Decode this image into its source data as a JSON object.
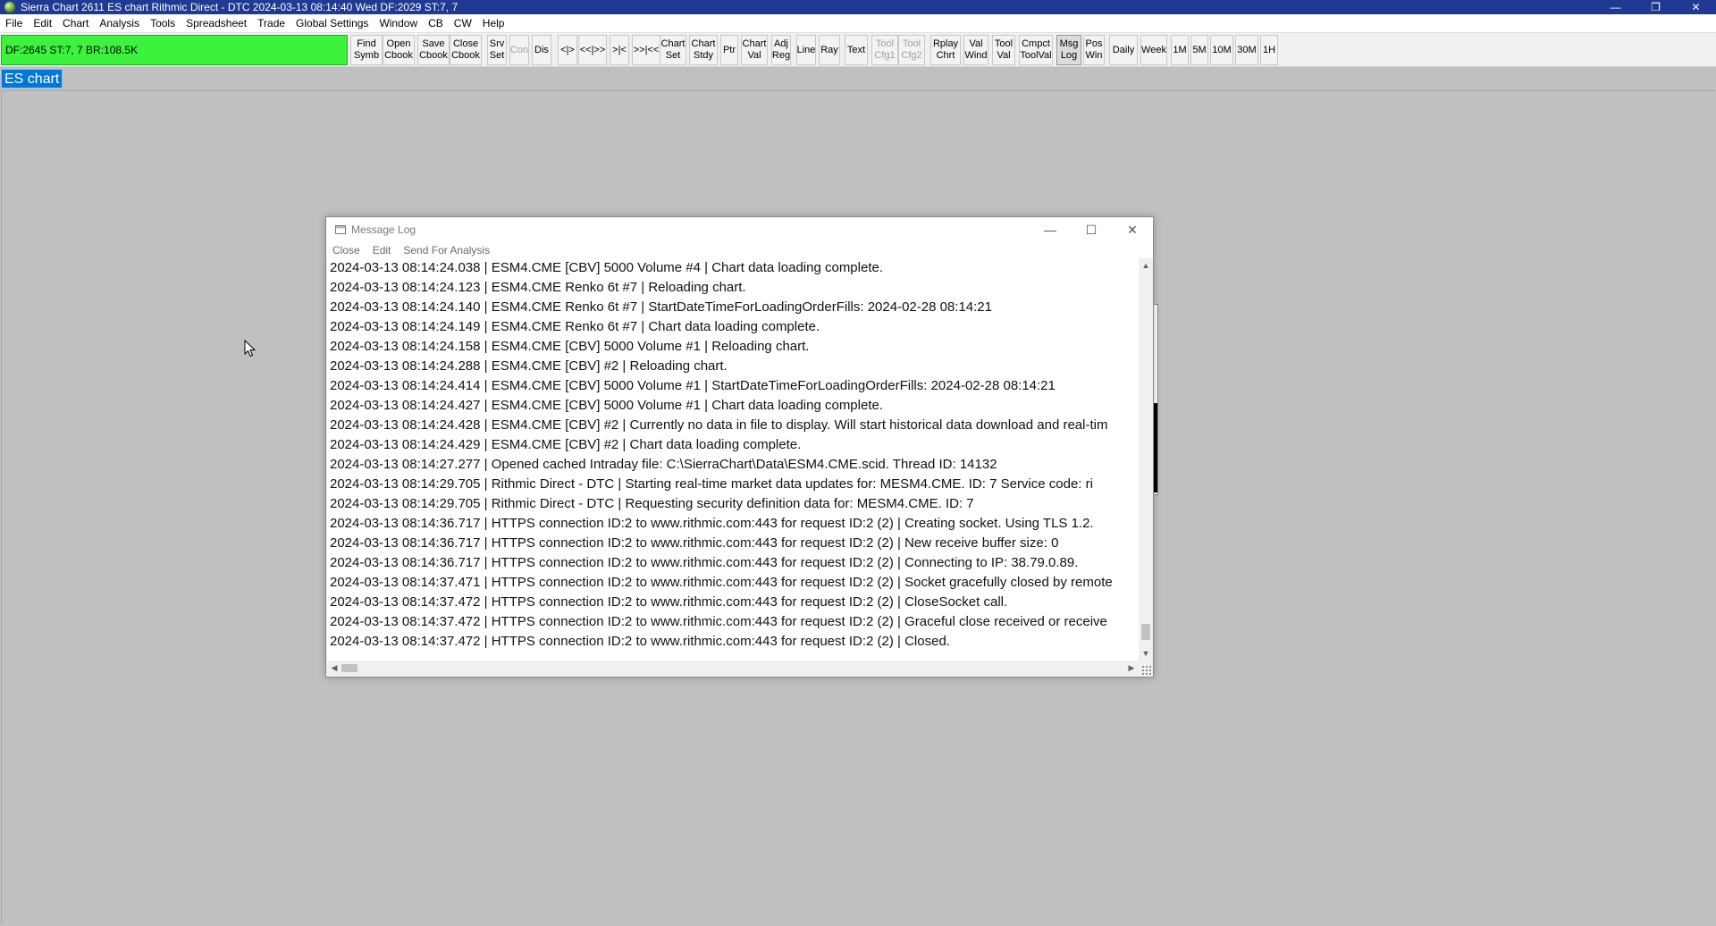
{
  "window": {
    "title": "Sierra Chart 2611 ES chart Rithmic Direct - DTC 2024-03-13  08:14:40 Wed DF:2029  ST:7, 7",
    "controls": {
      "minimize": "—",
      "restore": "❐",
      "close": "✕"
    }
  },
  "menu": [
    "File",
    "Edit",
    "Chart",
    "Analysis",
    "Tools",
    "Spreadsheet",
    "Trade",
    "Global Settings",
    "Window",
    "CB",
    "CW",
    "Help"
  ],
  "status_panel": {
    "text": "DF:2645  ST:7, 7  BR:108.5K",
    "color": "#3cf23c"
  },
  "toolbar": {
    "buttons": [
      {
        "line1": "Find",
        "line2": "Symb",
        "state": "normal"
      },
      {
        "line1": "Open",
        "line2": "Cbook",
        "state": "normal"
      },
      {
        "line1": "Save",
        "line2": "Cbook",
        "state": "normal"
      },
      {
        "line1": "Close",
        "line2": "Cbook",
        "state": "normal"
      },
      {
        "line1": "Srv",
        "line2": "Set",
        "state": "normal"
      },
      {
        "line1": "Con",
        "line2": "",
        "state": "disabled"
      },
      {
        "line1": "Dis",
        "line2": "",
        "state": "normal"
      },
      {
        "line1": "<|>",
        "line2": "",
        "state": "normal"
      },
      {
        "line1": "<<|>>",
        "line2": "",
        "state": "normal"
      },
      {
        "line1": ">|<",
        "line2": "",
        "state": "normal"
      },
      {
        "line1": ">>|<<",
        "line2": "",
        "state": "normal"
      },
      {
        "line1": "Chart",
        "line2": "Set",
        "state": "normal"
      },
      {
        "line1": "Chart",
        "line2": "Stdy",
        "state": "normal"
      },
      {
        "line1": "Ptr",
        "line2": "",
        "state": "normal"
      },
      {
        "line1": "Chart",
        "line2": "Val",
        "state": "normal"
      },
      {
        "line1": "Adj",
        "line2": "Reg",
        "state": "normal"
      },
      {
        "line1": "Line",
        "line2": "",
        "state": "normal"
      },
      {
        "line1": "Ray",
        "line2": "",
        "state": "normal"
      },
      {
        "line1": "Text",
        "line2": "",
        "state": "normal"
      },
      {
        "line1": "Tool",
        "line2": "Cfg1",
        "state": "disabled"
      },
      {
        "line1": "Tool",
        "line2": "Cfg2",
        "state": "disabled"
      },
      {
        "line1": "Rplay",
        "line2": "Chrt",
        "state": "normal"
      },
      {
        "line1": "Val",
        "line2": "Wind",
        "state": "normal"
      },
      {
        "line1": "Tool",
        "line2": "Val",
        "state": "normal"
      },
      {
        "line1": "Cmpct",
        "line2": "ToolVal",
        "state": "normal"
      },
      {
        "line1": "Msg",
        "line2": "Log",
        "state": "pressed"
      },
      {
        "line1": "Pos",
        "line2": "Win",
        "state": "normal"
      },
      {
        "line1": "Daily",
        "line2": "",
        "state": "normal"
      },
      {
        "line1": "Week",
        "line2": "",
        "state": "normal"
      },
      {
        "line1": "1M",
        "line2": "",
        "state": "normal"
      },
      {
        "line1": "5M",
        "line2": "",
        "state": "normal"
      },
      {
        "line1": "10M",
        "line2": "",
        "state": "normal"
      },
      {
        "line1": "30M",
        "line2": "",
        "state": "normal"
      },
      {
        "line1": "1H",
        "line2": "",
        "state": "normal"
      }
    ]
  },
  "chart_tab": {
    "label": "ES chart",
    "color": "#0078d7"
  },
  "message_log": {
    "title": "Message Log",
    "menu": [
      "Close",
      "Edit",
      "Send For Analysis"
    ],
    "lines": [
      "2024-03-13  08:14:24.038 | ESM4.CME [CBV]  5000 Volume #4 | Chart data loading complete.",
      "2024-03-13  08:14:24.123 | ESM4.CME  Renko 6t #7 | Reloading chart.",
      "2024-03-13  08:14:24.140 | ESM4.CME  Renko 6t #7 | StartDateTimeForLoadingOrderFills: 2024-02-28  08:14:21",
      "2024-03-13  08:14:24.149 | ESM4.CME  Renko 6t #7 | Chart data loading complete.",
      "2024-03-13  08:14:24.158 | ESM4.CME [CBV]  5000 Volume #1 | Reloading chart.",
      "2024-03-13  08:14:24.288 | ESM4.CME [CBV] #2 | Reloading chart.",
      "2024-03-13  08:14:24.414 | ESM4.CME [CBV]  5000 Volume #1 | StartDateTimeForLoadingOrderFills: 2024-02-28  08:14:21",
      "2024-03-13  08:14:24.427 | ESM4.CME [CBV]  5000 Volume #1 | Chart data loading complete.",
      "2024-03-13  08:14:24.428 | ESM4.CME [CBV] #2 | Currently no data in file to display. Will start historical data download and real-tim",
      "2024-03-13  08:14:24.429 | ESM4.CME [CBV] #2 | Chart data loading complete.",
      "2024-03-13  08:14:27.277 | Opened cached Intraday file: C:\\SierraChart\\Data\\ESM4.CME.scid. Thread ID: 14132",
      "2024-03-13  08:14:29.705 | Rithmic Direct - DTC | Starting real-time market data updates for: MESM4.CME.  ID: 7  Service code: ri",
      "2024-03-13  08:14:29.705 | Rithmic Direct - DTC | Requesting security definition data for: MESM4.CME.  ID: 7",
      "2024-03-13  08:14:36.717 | HTTPS connection ID:2 to www.rithmic.com:443 for request ID:2 (2) | Creating socket.  Using TLS 1.2.",
      "2024-03-13  08:14:36.717 | HTTPS connection ID:2 to www.rithmic.com:443 for request ID:2 (2) | New receive buffer size: 0",
      "2024-03-13  08:14:36.717 | HTTPS connection ID:2 to www.rithmic.com:443 for request ID:2 (2) | Connecting to IP: 38.79.0.89.",
      "2024-03-13  08:14:37.471 | HTTPS connection ID:2 to www.rithmic.com:443 for request ID:2 (2) | Socket gracefully closed by remote",
      "2024-03-13  08:14:37.472 | HTTPS connection ID:2 to www.rithmic.com:443 for request ID:2 (2) | CloseSocket call.",
      "2024-03-13  08:14:37.472 | HTTPS connection ID:2 to www.rithmic.com:443 for request ID:2 (2) | Graceful close received or receive",
      "2024-03-13  08:14:37.472 | HTTPS connection ID:2 to www.rithmic.com:443 for request ID:2 (2) | Closed."
    ]
  }
}
